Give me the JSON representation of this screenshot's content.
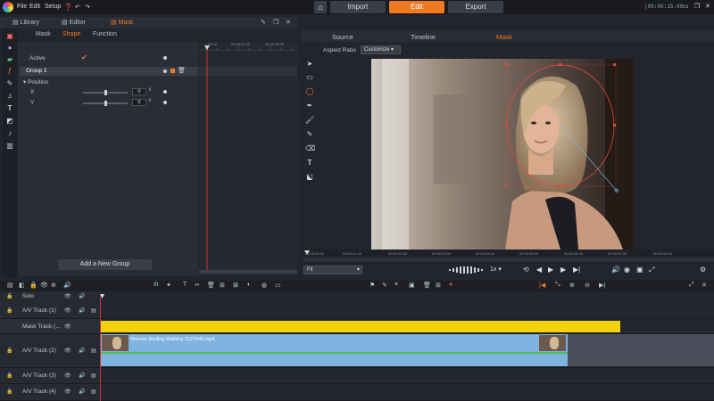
{
  "app": {
    "menu": [
      "File",
      "Edit",
      "Setup"
    ],
    "top_tabs": [
      {
        "label": "Import",
        "active": false
      },
      {
        "label": "Edit",
        "active": true
      },
      {
        "label": "Export",
        "active": false
      }
    ],
    "timecode": "00:00:15.00",
    "accent_color": "#f07a22"
  },
  "left_panel": {
    "tabs": [
      {
        "label": "Library",
        "active": false
      },
      {
        "label": "Editor",
        "active": false
      },
      {
        "label": "Mask",
        "active": true
      }
    ],
    "subtabs": [
      {
        "label": "Mask",
        "active": false
      },
      {
        "label": "Shape",
        "active": true
      },
      {
        "label": "Function",
        "active": false
      }
    ],
    "active_label": "Active",
    "group_label": "Group 1",
    "position_label": "Position",
    "x_label": "X",
    "y_label": "Y",
    "x_value": "0",
    "y_value": "0",
    "add_group_label": "Add a New Group",
    "kf_times": [
      "00:00",
      "00:00:04:00",
      "00:00:08:00"
    ]
  },
  "right_panel": {
    "tabs": [
      {
        "label": "Source",
        "active": false
      },
      {
        "label": "Timeline",
        "active": false
      },
      {
        "label": "Mask",
        "active": true
      }
    ],
    "aspect_label": "Aspect Ratio",
    "aspect_value": "Customize",
    "fit_value": "Fit",
    "speed_value": "1x",
    "ruler_times": [
      "00:00:00.00",
      "00:00:01.00",
      "00:00:02.00",
      "00:00:03.00",
      "00:00:04.00",
      "00:00:05.00",
      "00:00:06.00",
      "00:00:07.00",
      "00:00:08.00"
    ]
  },
  "timeline": {
    "solo_label": "Solo",
    "tracks": [
      {
        "name": "A/V Track (1)"
      },
      {
        "name": "Mask Track (..."
      },
      {
        "name": "A/V Track (2)"
      },
      {
        "name": "A/V Track (3)"
      },
      {
        "name": "A/V Track (4)"
      }
    ],
    "clip_name": "Woman Smiling Walking 2127849.mp4",
    "mask_color": "#f4d20a",
    "clip_color": "#7fb3e0"
  }
}
